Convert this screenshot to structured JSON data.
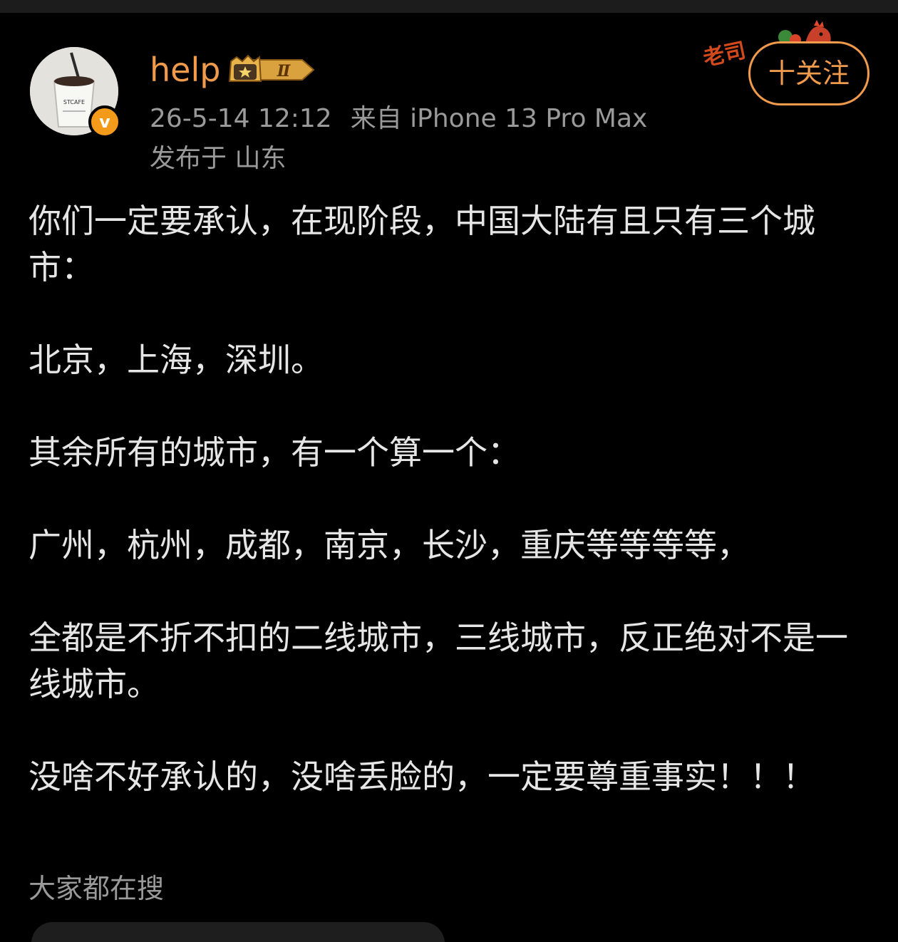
{
  "post": {
    "author": {
      "name": "help",
      "level_badge": "Ⅱ",
      "verified_mark": "v",
      "avatar_text": "STCAFE"
    },
    "timestamp": "26-5-14 12:12",
    "source": "来自 iPhone 13 Pro Max",
    "location": "发布于 山东",
    "follow_label": "十关注",
    "sticker_text": "老司",
    "body": [
      "你们一定要承认，在现阶段，中国大陆有且只有三个城市：",
      "北京，上海，深圳。",
      "其余所有的城市，有一个算一个：",
      "广州，杭州，成都，南京，长沙，重庆等等等等，",
      "全都是不折不扣的二线城市，三线城市，反正绝对不是一线城市。",
      "没啥不好承认的，没啥丢脸的，一定要尊重事实！！！"
    ]
  },
  "footer": {
    "search_hint": "大家都在搜"
  },
  "colors": {
    "background": "#000000",
    "accent_orange": "#f09a4c",
    "meta_gray": "#9a9a9a",
    "body_text": "#e6e6e6",
    "verified_orange": "#f39a1b"
  },
  "icons": {
    "avatar": "coffee-cup-avatar",
    "verified": "verified-v-icon",
    "level": "crown-level-badge",
    "sticker": "rooster-sticker"
  }
}
